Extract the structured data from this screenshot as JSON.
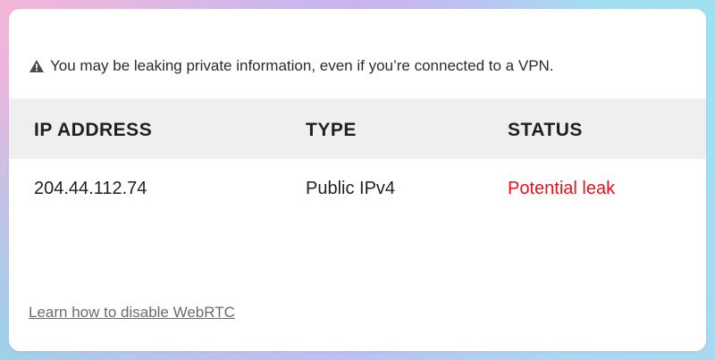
{
  "warning": {
    "icon": "warning-triangle-icon",
    "text": "You may be leaking private information, even if you’re connected to a VPN."
  },
  "table": {
    "headers": [
      "IP ADDRESS",
      "TYPE",
      "STATUS"
    ],
    "rows": [
      {
        "ip": "204.44.112.74",
        "type": "Public IPv4",
        "status": "Potential leak"
      }
    ]
  },
  "link": {
    "text": "Learn how to disable WebRTC"
  },
  "colors": {
    "status_leak": "#e8101c",
    "header_bg": "#efefef"
  }
}
